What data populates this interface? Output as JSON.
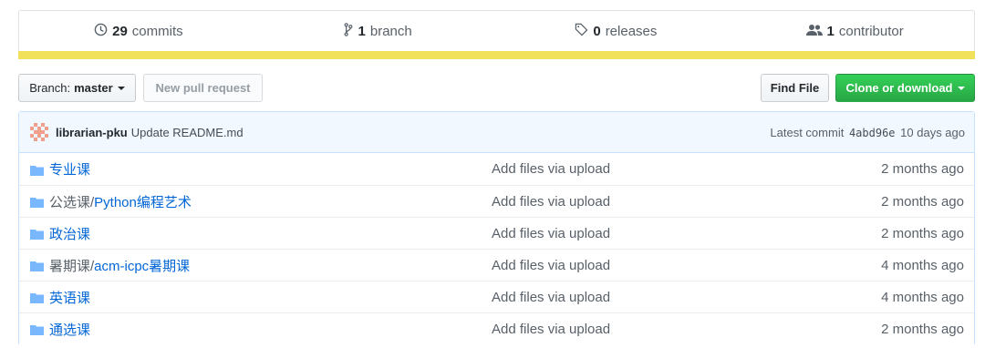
{
  "summary": {
    "commits": {
      "count": "29",
      "label": "commits"
    },
    "branches": {
      "count": "1",
      "label": "branch"
    },
    "releases": {
      "count": "0",
      "label": "releases"
    },
    "contributors": {
      "count": "1",
      "label": "contributor"
    },
    "language_color": "#f1e05a"
  },
  "toolbar": {
    "branch_prefix": "Branch:",
    "branch_name": "master",
    "new_pr_label": "New pull request",
    "find_file_label": "Find File",
    "clone_label": "Clone or download"
  },
  "commit": {
    "author": "librarian-pku",
    "message": "Update README.md",
    "latest_prefix": "Latest commit",
    "sha": "4abd96e",
    "age": "10 days ago"
  },
  "files": [
    {
      "prefix": "",
      "name": "专业课",
      "message": "Add files via upload",
      "age": "2 months ago"
    },
    {
      "prefix": "公选课/",
      "name": "Python编程艺术",
      "message": "Add files via upload",
      "age": "2 months ago"
    },
    {
      "prefix": "",
      "name": "政治课",
      "message": "Add files via upload",
      "age": "2 months ago"
    },
    {
      "prefix": "暑期课/",
      "name": "acm-icpc暑期课",
      "message": "Add files via upload",
      "age": "4 months ago"
    },
    {
      "prefix": "",
      "name": "英语课",
      "message": "Add files via upload",
      "age": "4 months ago"
    },
    {
      "prefix": "",
      "name": "通选课",
      "message": "Add files via upload",
      "age": "2 months ago"
    }
  ],
  "icons": {
    "commits": "history-icon",
    "branch": "git-branch-icon",
    "releases": "tag-icon",
    "contributors": "people-icon",
    "folder": "folder-icon"
  }
}
